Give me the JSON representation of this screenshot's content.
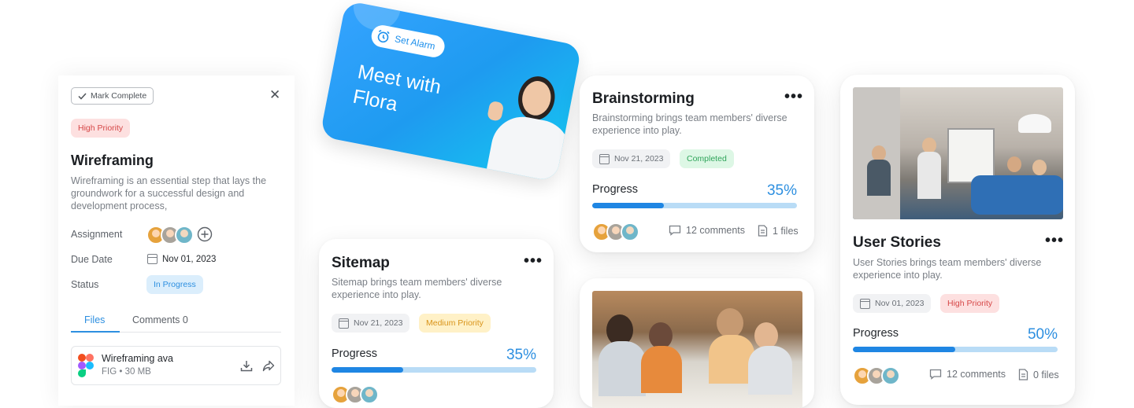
{
  "task_panel": {
    "mark_complete": "Mark Complete",
    "priority": "High Priority",
    "title": "Wireframing",
    "description": "Wireframing is an essential step that lays the groundwork for a successful design and development process,",
    "labels": {
      "assignment": "Assignment",
      "due_date": "Due Date",
      "status": "Status"
    },
    "due_date": "Nov 01, 2023",
    "status": "In Progress",
    "tabs": [
      {
        "label": "Files"
      },
      {
        "label": "Comments 0"
      }
    ],
    "file": {
      "name": "Wireframing ava",
      "meta": "FIG • 30 MB"
    }
  },
  "flora_card": {
    "alarm_label": "Set Alarm",
    "line1": "Meet with",
    "line2": "Flora"
  },
  "brainstorming": {
    "title": "Brainstorming",
    "description": "Brainstorming brings team members' diverse experience into play.",
    "date": "Nov 21, 2023",
    "status": "Completed",
    "progress_label": "Progress",
    "progress_text": "35%",
    "progress": 0.35,
    "comments": "12 comments",
    "files": "1 files"
  },
  "sitemap": {
    "title": "Sitemap",
    "description": "Sitemap brings team members' diverse experience into play.",
    "date": "Nov 21, 2023",
    "priority": "Medium Priority",
    "progress_label": "Progress",
    "progress_text": "35%",
    "progress": 0.35
  },
  "user_stories": {
    "title": "User Stories",
    "description": "User Stories brings team members' diverse experience into play.",
    "date": "Nov 01, 2023",
    "priority": "High Priority",
    "progress_label": "Progress",
    "progress_text": "50%",
    "progress": 0.5,
    "comments": "12 comments",
    "files": "0 files"
  },
  "more_icon": "•••",
  "colors": {
    "accent": "#1f86e3",
    "bar_track": "#b9dcf6"
  }
}
